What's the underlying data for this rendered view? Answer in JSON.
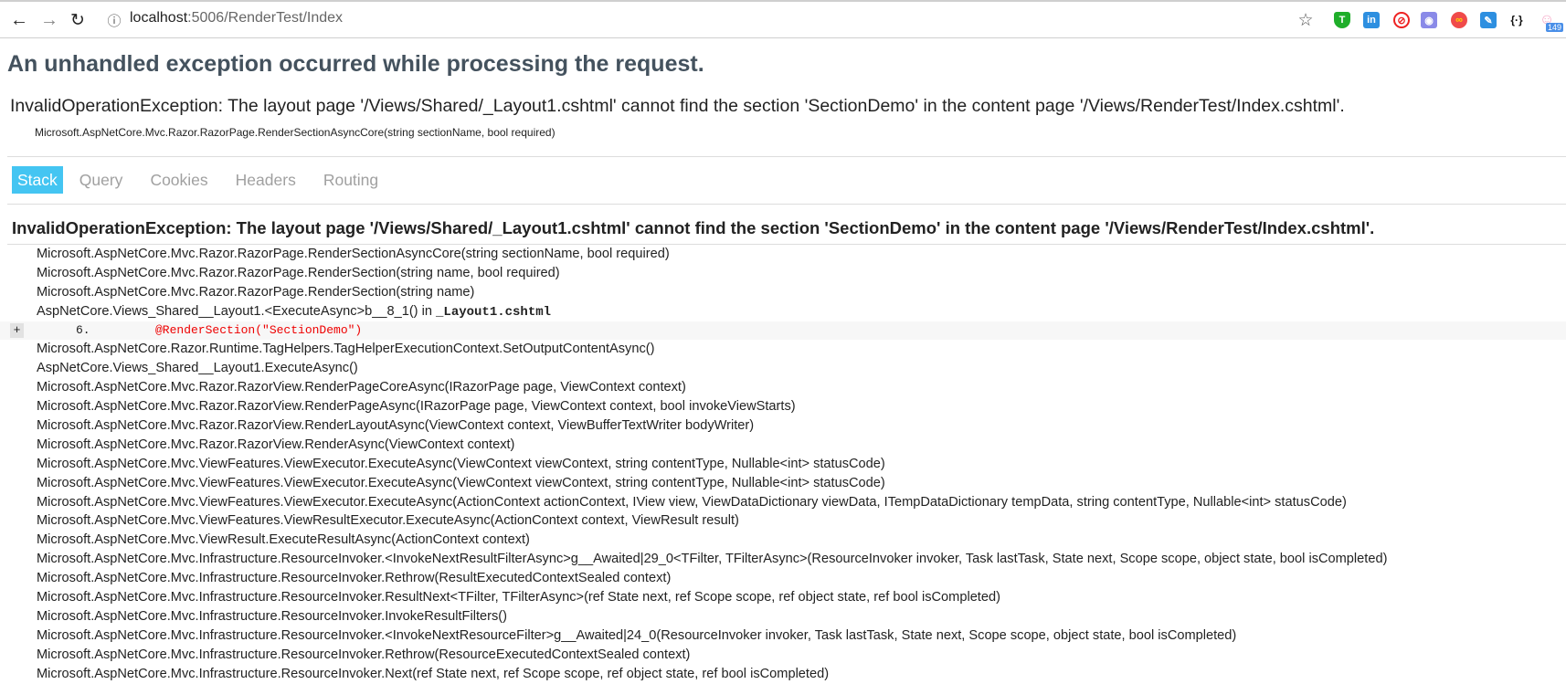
{
  "browser": {
    "url_host": "localhost",
    "url_rest": ":5006/RenderTest/Index",
    "extension_badge": "149",
    "icons": [
      "back-arrow-icon",
      "forward-arrow-icon",
      "reload-icon",
      "info-icon",
      "star-icon",
      "shield-t-icon",
      "linkedin-icon",
      "blocker-icon",
      "mask-icon",
      "infinity-icon",
      "pen-icon",
      "json-braces-icon",
      "cat-icon"
    ]
  },
  "page": {
    "title": "An unhandled exception occurred while processing the request.",
    "error_message": "InvalidOperationException: The layout page '/Views/Shared/_Layout1.cshtml' cannot find the section 'SectionDemo' in the content page '/Views/RenderTest/Index.cshtml'.",
    "error_location": "Microsoft.AspNetCore.Mvc.Razor.RazorPage.RenderSectionAsyncCore(string sectionName, bool required)",
    "tabs": [
      {
        "label": "Stack",
        "active": true
      },
      {
        "label": "Query",
        "active": false
      },
      {
        "label": "Cookies",
        "active": false
      },
      {
        "label": "Headers",
        "active": false
      },
      {
        "label": "Routing",
        "active": false
      }
    ],
    "stack_heading": "InvalidOperationException: The layout page '/Views/Shared/_Layout1.cshtml' cannot find the section 'SectionDemo' in the content page '/Views/RenderTest/Index.cshtml'.",
    "accent_color": "#44c5f2"
  },
  "stack": {
    "frames_before": [
      "Microsoft.AspNetCore.Mvc.Razor.RazorPage.RenderSectionAsyncCore(string sectionName, bool required)",
      "Microsoft.AspNetCore.Mvc.Razor.RazorPage.RenderSection(string name, bool required)",
      "Microsoft.AspNetCore.Mvc.Razor.RazorPage.RenderSection(string name)"
    ],
    "source_frame": {
      "method": "AspNetCore.Views_Shared__Layout1.<ExecuteAsync>b__8_1() in ",
      "file": "_Layout1.cshtml"
    },
    "expand_label": "+",
    "code_line_number": "6.",
    "code_line": "@RenderSection(\"SectionDemo\")",
    "frames_after": [
      "Microsoft.AspNetCore.Razor.Runtime.TagHelpers.TagHelperExecutionContext.SetOutputContentAsync()",
      "AspNetCore.Views_Shared__Layout1.ExecuteAsync()",
      "Microsoft.AspNetCore.Mvc.Razor.RazorView.RenderPageCoreAsync(IRazorPage page, ViewContext context)",
      "Microsoft.AspNetCore.Mvc.Razor.RazorView.RenderPageAsync(IRazorPage page, ViewContext context, bool invokeViewStarts)",
      "Microsoft.AspNetCore.Mvc.Razor.RazorView.RenderLayoutAsync(ViewContext context, ViewBufferTextWriter bodyWriter)",
      "Microsoft.AspNetCore.Mvc.Razor.RazorView.RenderAsync(ViewContext context)",
      "Microsoft.AspNetCore.Mvc.ViewFeatures.ViewExecutor.ExecuteAsync(ViewContext viewContext, string contentType, Nullable<int> statusCode)",
      "Microsoft.AspNetCore.Mvc.ViewFeatures.ViewExecutor.ExecuteAsync(ViewContext viewContext, string contentType, Nullable<int> statusCode)",
      "Microsoft.AspNetCore.Mvc.ViewFeatures.ViewExecutor.ExecuteAsync(ActionContext actionContext, IView view, ViewDataDictionary viewData, ITempDataDictionary tempData, string contentType, Nullable<int> statusCode)",
      "Microsoft.AspNetCore.Mvc.ViewFeatures.ViewResultExecutor.ExecuteAsync(ActionContext context, ViewResult result)",
      "Microsoft.AspNetCore.Mvc.ViewResult.ExecuteResultAsync(ActionContext context)",
      "Microsoft.AspNetCore.Mvc.Infrastructure.ResourceInvoker.<InvokeNextResultFilterAsync>g__Awaited|29_0<TFilter, TFilterAsync>(ResourceInvoker invoker, Task lastTask, State next, Scope scope, object state, bool isCompleted)",
      "Microsoft.AspNetCore.Mvc.Infrastructure.ResourceInvoker.Rethrow(ResultExecutedContextSealed context)",
      "Microsoft.AspNetCore.Mvc.Infrastructure.ResourceInvoker.ResultNext<TFilter, TFilterAsync>(ref State next, ref Scope scope, ref object state, ref bool isCompleted)",
      "Microsoft.AspNetCore.Mvc.Infrastructure.ResourceInvoker.InvokeResultFilters()",
      "Microsoft.AspNetCore.Mvc.Infrastructure.ResourceInvoker.<InvokeNextResourceFilter>g__Awaited|24_0(ResourceInvoker invoker, Task lastTask, State next, Scope scope, object state, bool isCompleted)",
      "Microsoft.AspNetCore.Mvc.Infrastructure.ResourceInvoker.Rethrow(ResourceExecutedContextSealed context)",
      "Microsoft.AspNetCore.Mvc.Infrastructure.ResourceInvoker.Next(ref State next, ref Scope scope, ref object state, ref bool isCompleted)"
    ]
  }
}
